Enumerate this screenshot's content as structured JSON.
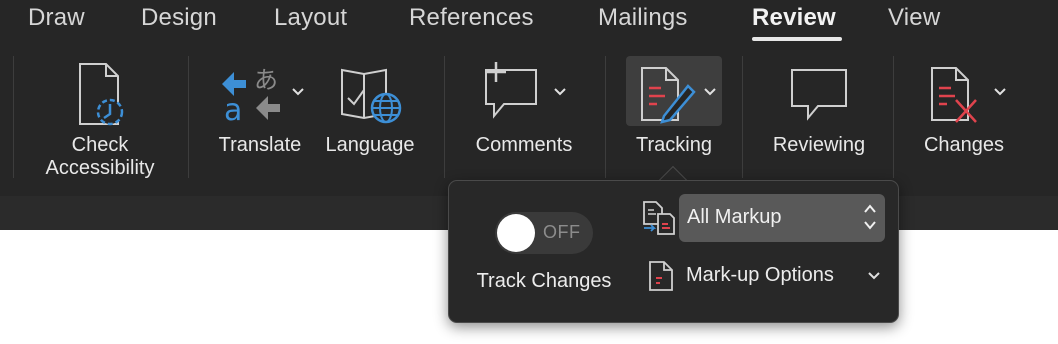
{
  "tabs": [
    {
      "label": "Draw"
    },
    {
      "label": "Design"
    },
    {
      "label": "Layout"
    },
    {
      "label": "References"
    },
    {
      "label": "Mailings"
    },
    {
      "label": "Review",
      "active": true
    },
    {
      "label": "View"
    }
  ],
  "groups": {
    "check_accessibility": {
      "line1": "Check",
      "line2": "Accessibility",
      "icon": "accessibility-check-icon"
    },
    "translate": {
      "label": "Translate",
      "icon": "translate-icon"
    },
    "language": {
      "label": "Language",
      "icon": "language-icon"
    },
    "comments": {
      "label": "Comments",
      "icon": "comment-add-icon"
    },
    "tracking": {
      "label": "Tracking",
      "icon": "tracking-pencil-icon"
    },
    "reviewing": {
      "label": "Reviewing",
      "icon": "speech-bubble-icon"
    },
    "changes": {
      "label": "Changes",
      "icon": "reject-change-icon"
    }
  },
  "popover": {
    "toggle_state": "OFF",
    "toggle_label": "Track Changes",
    "markup_select_value": "All Markup",
    "markup_options_label": "Mark-up Options"
  },
  "colors": {
    "ribbon_bg": "#262626",
    "accent_blue": "#3d8fd6",
    "accent_red": "#e0434d",
    "toggle_knob": "#ffffff"
  }
}
